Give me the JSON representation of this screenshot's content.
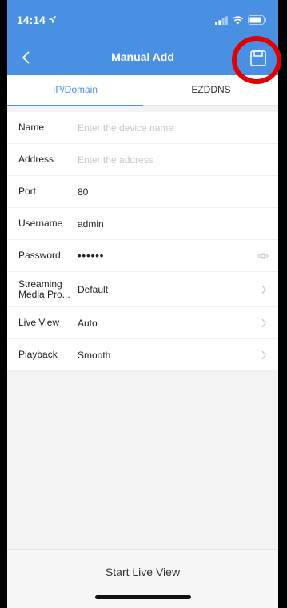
{
  "status_bar": {
    "time": "14:14"
  },
  "nav": {
    "title": "Manual Add"
  },
  "tabs": [
    {
      "label": "IP/Domain",
      "active": true
    },
    {
      "label": "EZDDNS",
      "active": false
    }
  ],
  "form": {
    "name": {
      "label": "Name",
      "placeholder": "Enter the device name",
      "value": ""
    },
    "address": {
      "label": "Address",
      "placeholder": "Enter the address",
      "value": ""
    },
    "port": {
      "label": "Port",
      "value": "80"
    },
    "username": {
      "label": "Username",
      "value": "admin"
    },
    "password": {
      "label": "Password",
      "value": "••••••"
    },
    "streaming": {
      "label": "Streaming Media Pro...",
      "value": "Default"
    },
    "live_view": {
      "label": "Live View",
      "value": "Auto"
    },
    "playback": {
      "label": "Playback",
      "value": "Smooth"
    }
  },
  "bottom": {
    "button_label": "Start Live View"
  },
  "colors": {
    "accent": "#4a90e2",
    "highlight_ring": "#e00000"
  },
  "icons": [
    "back-chevron-icon",
    "save-icon",
    "eye-icon",
    "chevron-right-icon",
    "signal-icon",
    "wifi-icon",
    "battery-icon",
    "location-arrow-icon"
  ]
}
